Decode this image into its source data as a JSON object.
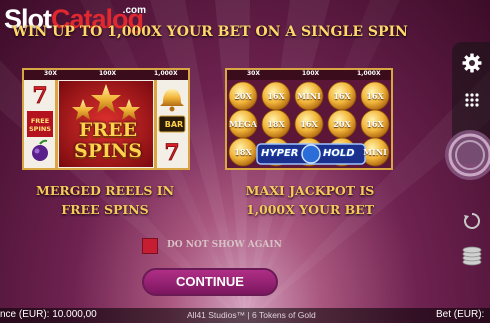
{
  "watermark": {
    "slot": "Slot",
    "catalog": "Catalog",
    "com": ".com"
  },
  "headline": "WIN UP TO 1,000X YOUR BET ON A SINGLE SPIN",
  "panel_free_spins": {
    "multipliers": [
      "30X",
      "100X",
      "1,000X"
    ],
    "badge": [
      "FREE",
      "SPINS"
    ],
    "side_free_spins": [
      "FREE",
      "SPINS"
    ],
    "bar_label": "BAR",
    "caption": [
      "MERGED REELS IN",
      "FREE SPINS"
    ]
  },
  "panel_hyper_hold": {
    "multipliers": [
      "30X",
      "100X",
      "1,000X"
    ],
    "coins": [
      [
        "20X",
        "16X",
        "MINI",
        "16X",
        "16X"
      ],
      [
        "MEGA",
        "18X",
        "16X",
        "20X",
        "16X"
      ],
      [
        "18X",
        "",
        "",
        "",
        "MINI"
      ]
    ],
    "badge_hyper": "HYPER",
    "badge_hold": "HOLD",
    "caption": [
      "MAXI JACKPOT IS",
      "1,000X YOUR BET"
    ]
  },
  "checkbox_label": "DO NOT SHOW AGAIN",
  "continue_label": "CONTINUE",
  "bottom": {
    "balance": "nce (EUR): 10.000,00",
    "game_title": "All41 Studios™ | 6 Tokens of Gold",
    "bet": "Bet (EUR):"
  },
  "colors": {
    "accent_gold": "#ffd66b",
    "checkbox": "#c51e33",
    "button": "#9c2478"
  },
  "icons": [
    "gear-icon",
    "menu-dots-icon",
    "spin-icon",
    "autoplay-icon",
    "coin-stack-icon"
  ]
}
